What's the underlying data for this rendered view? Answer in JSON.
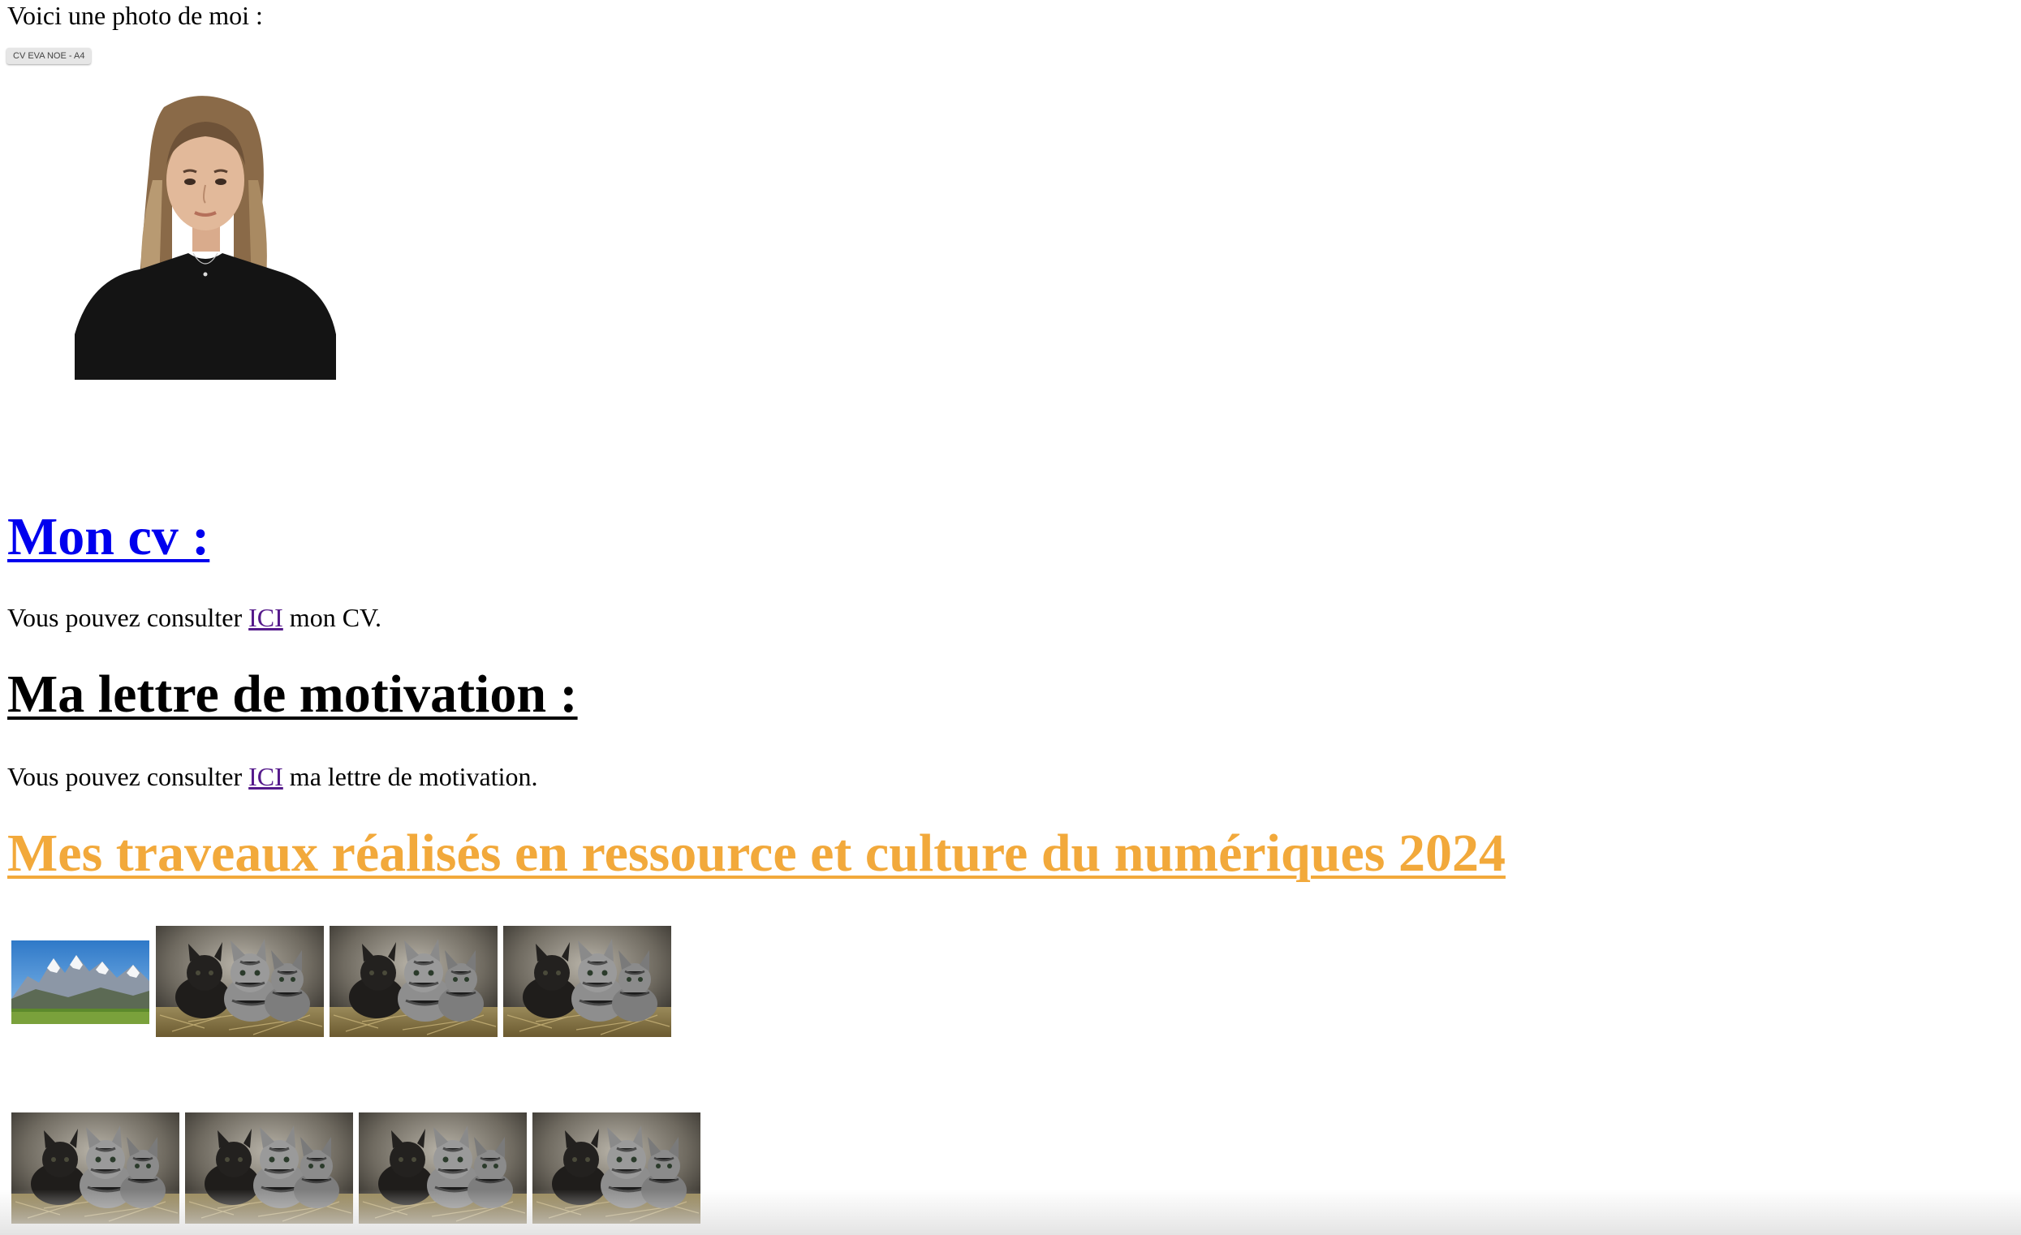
{
  "intro": {
    "text": "Voici une photo de moi :",
    "file_chip_label": "CV EVA NOE - A4"
  },
  "cv_section": {
    "heading": "Mon cv :",
    "text_before": "Vous pouvez consulter ",
    "link_label": "ICI",
    "text_after": " mon CV."
  },
  "lettre_section": {
    "heading": "Ma lettre de motivation :",
    "text_before": "Vous pouvez consulter ",
    "link_label": "ICI",
    "text_after": " ma lettre de motivation."
  },
  "travaux_section": {
    "heading": "Mes traveaux réalisés en ressource et culture du numériques 2024",
    "heading_color": "#f2a93b",
    "gallery_rows": [
      [
        "mountain-landscape",
        "kittens-on-hay",
        "kittens-on-hay",
        "kittens-on-hay"
      ],
      [
        "kittens-on-hay",
        "kittens-on-hay",
        "kittens-on-hay",
        "kittens-on-hay"
      ]
    ]
  },
  "colors": {
    "link_unvisited": "#0000ee",
    "link_visited": "#551a8b",
    "text": "#000000"
  }
}
